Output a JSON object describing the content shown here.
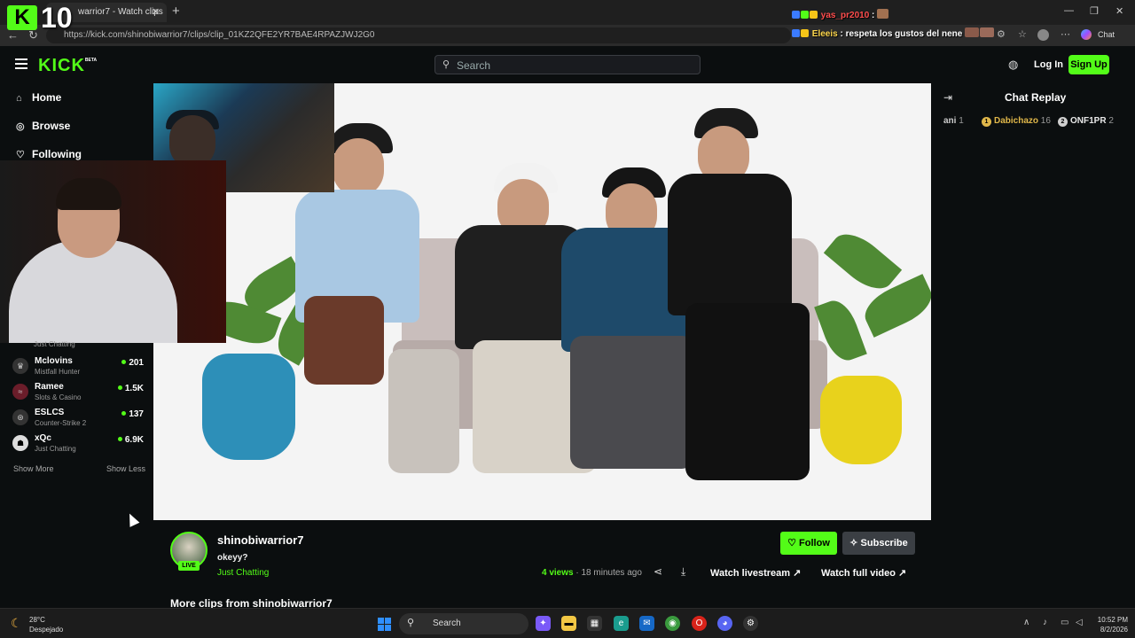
{
  "browser": {
    "tab_title": "warrior7 - Watch clips",
    "url": "https://kick.com/shinobiwarrior7/clips/clip_01KZ2QFE2YR7BAE4RPAZJWJ2G0",
    "close_glyph": "✕",
    "new_tab_glyph": "+",
    "chat_label": "Chat"
  },
  "overlay": {
    "logo_letter": "K",
    "rank_number": "10",
    "chat_lines": [
      {
        "user": "yas_pr2010",
        "text": " :"
      },
      {
        "user": "Eleeis",
        "text": " : respeta los gustos del nene"
      }
    ]
  },
  "header": {
    "logo": "KICK",
    "logo_badge": "BETA",
    "search_placeholder": "Search",
    "login": "Log In",
    "signup": "Sign Up"
  },
  "sidebar": {
    "nav": [
      {
        "label": "Home",
        "icon": "home-icon",
        "glyph": "⌂"
      },
      {
        "label": "Browse",
        "icon": "browse-icon",
        "glyph": "◎"
      },
      {
        "label": "Following",
        "icon": "heart-icon",
        "glyph": "♡"
      }
    ],
    "partial_category": "Just Chatting",
    "channels": [
      {
        "name": "Mclovins",
        "category": "Mistfall Hunter",
        "viewers": "201"
      },
      {
        "name": "Ramee",
        "category": "Slots & Casino",
        "viewers": "1.5K"
      },
      {
        "name": "ESLCS",
        "category": "Counter-Strike 2",
        "viewers": "137"
      },
      {
        "name": "xQc",
        "category": "Just Chatting",
        "viewers": "6.9K"
      }
    ],
    "show_more": "Show More",
    "show_less": "Show Less"
  },
  "clip": {
    "channel": "shinobiwarrior7",
    "live_badge": "LIVE",
    "title": "okeyy?",
    "category": "Just Chatting",
    "follow": "Follow",
    "subscribe": "Subscribe",
    "views_count": "4",
    "views_label": "views",
    "separator": "·",
    "age": "18 minutes ago",
    "watch_livestream": "Watch livestream",
    "watch_full_video": "Watch full video",
    "more_clips": "More clips from shinobiwarrior7"
  },
  "chat": {
    "title": "Chat Replay",
    "leaders": [
      {
        "name": "ani",
        "count": "1",
        "badge_color": "#ffffff"
      },
      {
        "name": "Dabichazo",
        "count": "16",
        "badge_color": "#e0b74a"
      },
      {
        "name": "ONF1PR",
        "count": "2",
        "badge_color": "#cfcfcf"
      }
    ]
  },
  "taskbar": {
    "temperature": "28°C",
    "weather": "Despejado",
    "search": "Search",
    "time": "10:52 PM",
    "date": "8/2/2026"
  },
  "colors": {
    "kick_green": "#53fc18",
    "background": "#0b0e0f",
    "subscribe_bg": "#3b3f44"
  }
}
